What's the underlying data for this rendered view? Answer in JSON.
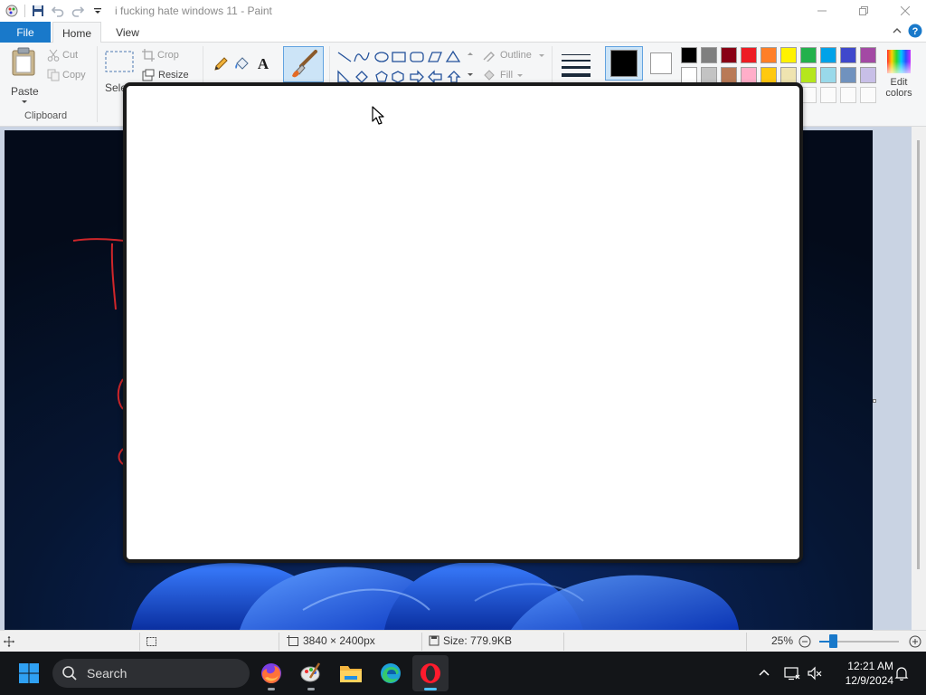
{
  "window": {
    "title": "i fucking hate windows 11 - Paint",
    "controls": {
      "minimize": "minimize-icon",
      "restore": "restore-icon",
      "close": "close-icon"
    }
  },
  "ribbon_tabs": {
    "file": "File",
    "home": "Home",
    "view": "View"
  },
  "ribbon": {
    "clipboard": {
      "paste": "Paste",
      "cut": "Cut",
      "copy": "Copy",
      "group": "Clipboard"
    },
    "image": {
      "select": "Sele",
      "crop": "Crop",
      "resize": "Resize"
    },
    "shapes": {
      "outline": "Outline",
      "fill": "Fill"
    },
    "edit_colors": [
      "Edit",
      "colors"
    ],
    "color1": "#000000",
    "color2": "#ffffff",
    "palette_row1": [
      "#000000",
      "#7f7f7f",
      "#880015",
      "#ed1c24",
      "#ff7f27",
      "#fff200",
      "#22b14c",
      "#00a2e8",
      "#3f48cc",
      "#a349a4"
    ],
    "palette_row2": [
      "#ffffff",
      "#c3c3c3",
      "#b97a57",
      "#ffaec9",
      "#ffc90e",
      "#efe4b0",
      "#b5e61d",
      "#99d9ea",
      "#7092be",
      "#c8bfe7"
    ]
  },
  "statusbar": {
    "dimensions": "3840 × 2400px",
    "size": "Size: 779.9KB",
    "zoom": "25%",
    "zoom_fraction": 0.25
  },
  "taskbar": {
    "search": "Search",
    "apps": [
      "firefox-icon",
      "paint-icon",
      "file-explorer-icon",
      "edge-icon",
      "opera-icon"
    ],
    "time": "12:21 AM",
    "date": "12/9/2024"
  }
}
